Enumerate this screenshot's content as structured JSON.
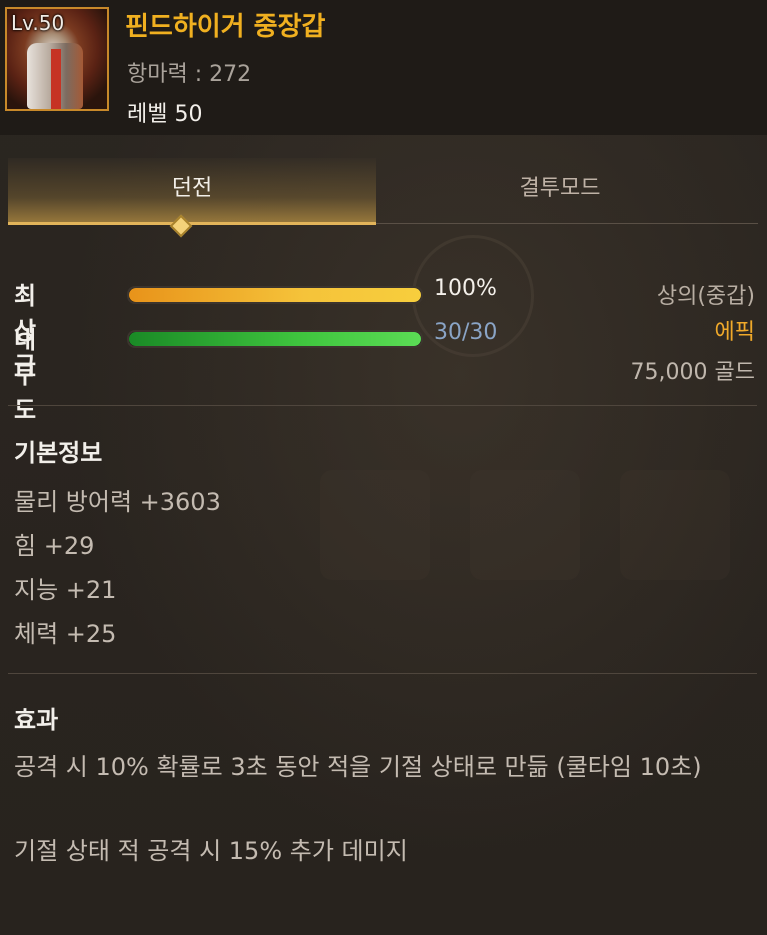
{
  "item": {
    "level_badge": "Lv.50",
    "name": "핀드하이거 중장갑",
    "spell_resist": "항마력 : 272",
    "required_level": "레벨 50",
    "icon": "heavy-armor-icon"
  },
  "tabs": [
    {
      "label": "던전",
      "active": true
    },
    {
      "label": "결투모드",
      "active": false
    }
  ],
  "bars": {
    "quality": {
      "label": "최상급",
      "value": "100%",
      "fraction": 1.0
    },
    "durability": {
      "label": "내구도",
      "value": "30/30",
      "fraction": 1.0
    }
  },
  "meta": {
    "slot": "상의(중갑)",
    "rarity": "에픽",
    "price": "75,000 골드"
  },
  "basic_info": {
    "title": "기본정보",
    "stats": [
      "물리 방어력 +3603",
      "힘 +29",
      "지능 +21",
      "체력 +25"
    ]
  },
  "effect": {
    "title": "효과",
    "lines": [
      "공격 시 10% 확률로 3초 동안 적을 기절 상태로 만듦 (쿨타임 10초)",
      "기절 상태 적 공격 시 15% 추가 데미지"
    ]
  },
  "colors": {
    "item_name": "#f0b020",
    "rarity_epic": "#f0a92a",
    "quality_bar": "#f5c33a",
    "durability_bar": "#40c63f",
    "durability_text": "#8aa4c6"
  }
}
